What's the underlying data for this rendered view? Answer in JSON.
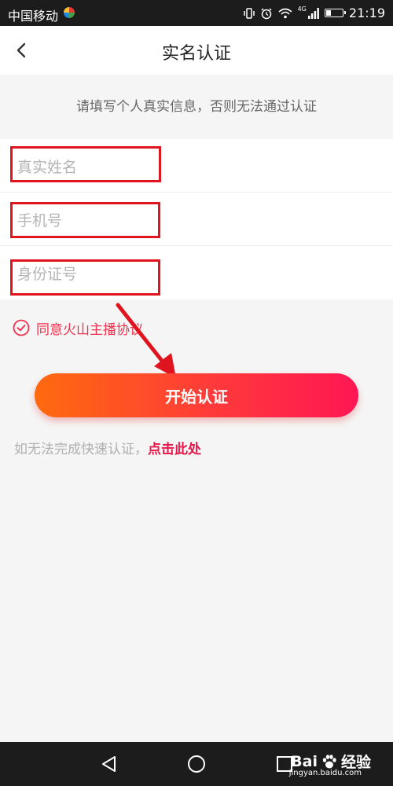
{
  "status_bar": {
    "carrier": "中国移动",
    "network_label": "4G",
    "time": "21:19",
    "battery_level": 0.3
  },
  "header": {
    "title": "实名认证",
    "back_icon": "chevron-left-icon"
  },
  "notice": "请填写个人真实信息，否则无法通过认证",
  "form": {
    "name_placeholder": "真实姓名",
    "phone_placeholder": "手机号",
    "id_placeholder": "身份证号"
  },
  "agreement": {
    "label": "同意火山主播协议",
    "checked": true
  },
  "start_button": "开始认证",
  "fallback": {
    "text": "如无法完成快速认证，",
    "link": "点击此处"
  },
  "watermark": {
    "brand_left": "Bai",
    "brand_right": "经验",
    "url": "jingyan.baidu.com"
  },
  "colors": {
    "accent": "#f0324f",
    "link": "#e8174a",
    "button_start": "#ff6a0f",
    "button_end": "#ff1653",
    "annotation": "#e0141e"
  }
}
